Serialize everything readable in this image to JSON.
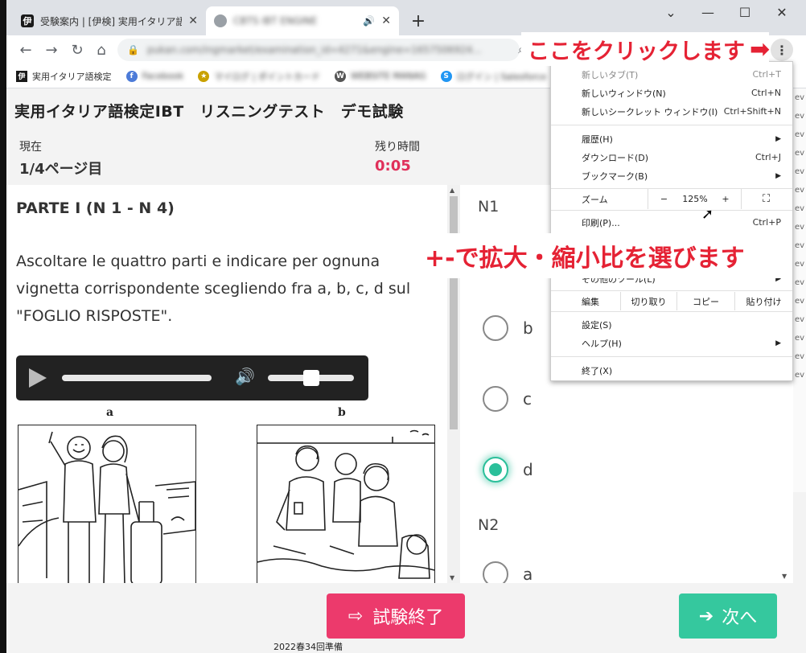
{
  "browser": {
    "tabs": [
      {
        "icon": "伊",
        "title": "受験案内 | [伊検] 実用イタリア語検",
        "active": false
      },
      {
        "icon": "",
        "title": "CBTS IBT ENGINE",
        "active": true
      }
    ],
    "new_tab": "+",
    "window_controls": {
      "minimize": "—",
      "maximize": "☐",
      "close": "✕"
    },
    "url": "pukan.com/ingmarket/examination_id=4271&engine=1657506924...",
    "bookmarks": [
      {
        "icon": "伊",
        "label": "実用イタリア語検定"
      },
      {
        "icon": "f",
        "label": "Facebook"
      },
      {
        "icon": "★",
        "label": "マイログ | ポイントカード"
      },
      {
        "icon": "W",
        "label": "WEBSITE MANAG"
      },
      {
        "icon": "S",
        "label": "ログイン | Salesforce"
      }
    ]
  },
  "page": {
    "title": "実用イタリア語検定IBT　リスニングテスト　デモ試験",
    "current_label": "現在",
    "current_value": "1/4ページ目",
    "remaining_label": "残り時間",
    "remaining_value": "0:05"
  },
  "question": {
    "part_title": "PARTE I (N 1 - N 4)",
    "instructions": "Ascoltare le quattro parti e indicare per ognuna vignetta corrispondente scegliendo fra a, b, c, d sul \"FOGLIO RISPOSTE\".",
    "audio": {
      "seek_progress": 0,
      "volume": 0.5
    },
    "image_labels": [
      "a",
      "b"
    ]
  },
  "answers": {
    "groups": [
      {
        "label": "N1",
        "options": [
          "b",
          "c",
          "d"
        ],
        "selected": "d"
      },
      {
        "label": "N2",
        "options": [
          "a"
        ],
        "selected": null
      }
    ]
  },
  "footer": {
    "end_button": "試験終了",
    "next_button": "次へ"
  },
  "menu": {
    "items_top": [
      {
        "label": "新しいタブ(T)",
        "shortcut": "Ctrl+T"
      },
      {
        "label": "新しいウィンドウ(N)",
        "shortcut": "Ctrl+N"
      },
      {
        "label": "新しいシークレット ウィンドウ(I)",
        "shortcut": "Ctrl+Shift+N"
      }
    ],
    "items_mid": [
      {
        "label": "履歴(H)",
        "shortcut": "",
        "submenu": true
      },
      {
        "label": "ダウンロード(D)",
        "shortcut": "Ctrl+J",
        "submenu": false
      },
      {
        "label": "ブックマーク(B)",
        "shortcut": "",
        "submenu": true
      }
    ],
    "zoom": {
      "label": "ズーム",
      "minus": "−",
      "value": "125%",
      "plus": "+"
    },
    "print": {
      "label": "印刷(P)...",
      "shortcut": "Ctrl+P"
    },
    "more_tools": "その他のツール(L)",
    "edit": {
      "label": "編集",
      "cut": "切り取り",
      "copy": "コピー",
      "paste": "貼り付け"
    },
    "settings": "設定(S)",
    "help": "ヘルプ(H)",
    "exit": "終了(X)"
  },
  "annotations": {
    "click_here": "ここをクリックします",
    "zoom_hint": "+-で拡大・縮小比を選びます"
  },
  "background_peek": {
    "taskbar_text": "2022春34回準備",
    "side_items": [
      "ev",
      "ev",
      "ev",
      "ev",
      "ev",
      "ev",
      "ev",
      "ev",
      "ev",
      "ev",
      "ev",
      "ev",
      "ev",
      "ev",
      "ev",
      "ev"
    ]
  }
}
